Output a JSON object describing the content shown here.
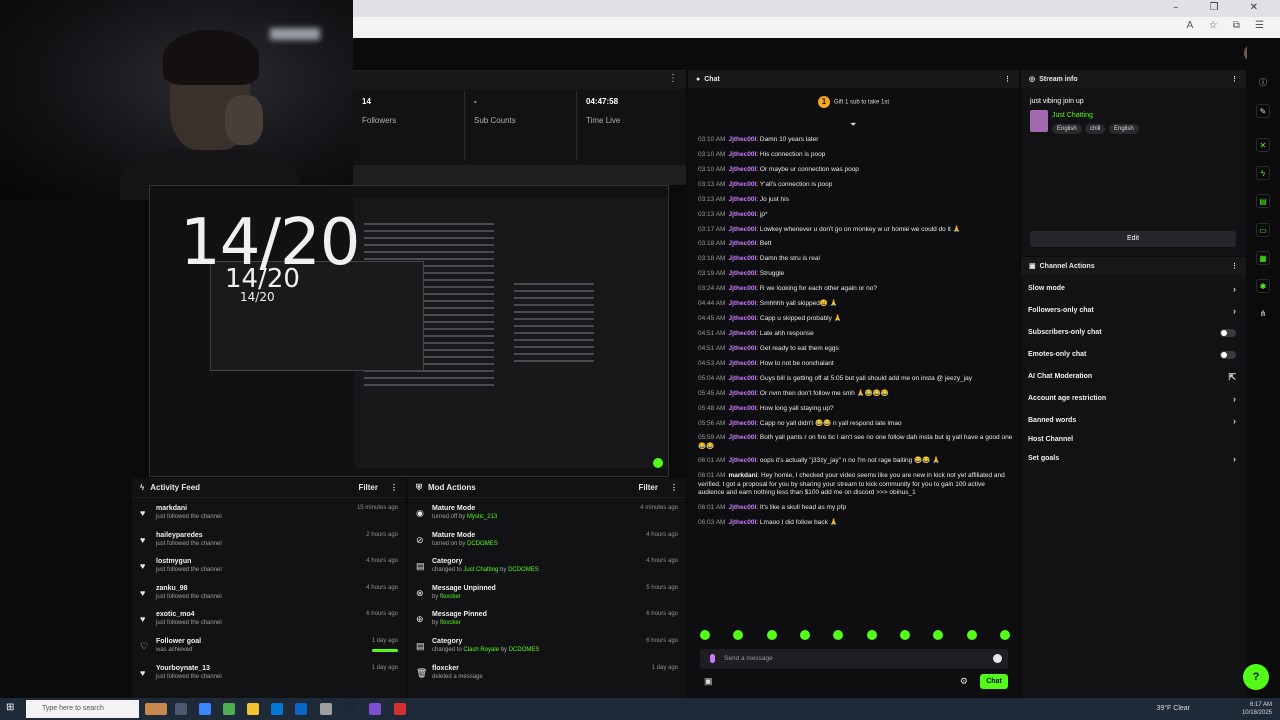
{
  "stats": [
    {
      "value": "14",
      "label": "Followers"
    },
    {
      "value": "-",
      "label": "Sub Counts"
    },
    {
      "value": "04:47:58",
      "label": "Time Live"
    }
  ],
  "preview": {
    "big": "14/20",
    "mid": "14/20",
    "small": "14/20"
  },
  "activity_feed": {
    "title": "Activity Feed",
    "filter": "Filter",
    "items": [
      {
        "name": "markdani",
        "sub": "just followed the channel",
        "time": "15 minutes ago"
      },
      {
        "name": "haileyparedes",
        "sub": "just followed the channel",
        "time": "2 hours ago"
      },
      {
        "name": "lostmygun",
        "sub": "just followed the channel",
        "time": "4 hours ago"
      },
      {
        "name": "zanku_98",
        "sub": "just followed the channel",
        "time": "4 hours ago"
      },
      {
        "name": "exotic_mo4",
        "sub": "just followed the channel",
        "time": "6 hours ago"
      },
      {
        "name": "Follower goal",
        "sub": "was achieved",
        "time": "1 day ago"
      },
      {
        "name": "Yourboynate_13",
        "sub": "just followed the channel",
        "time": "1 day ago"
      }
    ]
  },
  "mod_actions": {
    "title": "Mod Actions",
    "filter": "Filter",
    "items": [
      {
        "name": "Mature Mode",
        "pre": "turned off by ",
        "who": "Mystic_213",
        "post": "",
        "time": "4 minutes ago"
      },
      {
        "name": "Mature Mode",
        "pre": "turned on by ",
        "who": "DCDOMES",
        "post": "",
        "time": "4 hours ago"
      },
      {
        "name": "Category",
        "pre": "changed to ",
        "who": "Just Chatting",
        "post": " by ",
        "who2": "DCDOMES",
        "time": "4 hours ago"
      },
      {
        "name": "Message Unpinned",
        "pre": "by ",
        "who": "floxcker",
        "post": "",
        "time": "5 hours ago"
      },
      {
        "name": "Message Pinned",
        "pre": "by ",
        "who": "floxcker",
        "post": "",
        "time": "6 hours ago"
      },
      {
        "name": "Category",
        "pre": "changed to ",
        "who": "Clash Royale",
        "post": " by ",
        "who2": "DCDOMES",
        "time": "6 hours ago"
      },
      {
        "name": "floxcker",
        "pre": "deleted a message",
        "who": "",
        "post": "",
        "time": "1 day ago"
      }
    ]
  },
  "chat": {
    "title": "Chat",
    "gift_text": "Gift 1 sub to take 1st",
    "gift_count": "1",
    "input_placeholder": "Send a message",
    "send_label": "Chat",
    "messages": [
      {
        "time": "03:10 AM",
        "user": "Jjthec00l",
        "text": "Damn 10 years later"
      },
      {
        "time": "03:10 AM",
        "user": "Jjthec00l",
        "text": "His connection is poop"
      },
      {
        "time": "03:10 AM",
        "user": "Jjthec00l",
        "text": "Or maybe ur connection was poop"
      },
      {
        "time": "03:13 AM",
        "user": "Jjthec00l",
        "text": "Y'all's connection is poop"
      },
      {
        "time": "03:13 AM",
        "user": "Jjthec00l",
        "text": "Jo just his"
      },
      {
        "time": "03:13 AM",
        "user": "Jjthec00l",
        "text": "jp*"
      },
      {
        "time": "03:17 AM",
        "user": "Jjthec00l",
        "text": "Lowkey whenever u don't go on monkey w ur homie we could do it 🙏"
      },
      {
        "time": "03:18 AM",
        "user": "Jjthec00l",
        "text": "Bett"
      },
      {
        "time": "03:18 AM",
        "user": "Jjthec00l",
        "text": "Damn the stru is real"
      },
      {
        "time": "03:19 AM",
        "user": "Jjthec00l",
        "text": "Struggle"
      },
      {
        "time": "03:24 AM",
        "user": "Jjthec00l",
        "text": "R we looking for each other again or no?"
      },
      {
        "time": "04:44 AM",
        "user": "Jjthec00l",
        "text": "Smhhhh yall skipped😩 🙏"
      },
      {
        "time": "04:45 AM",
        "user": "Jjthec00l",
        "text": "Capp u skipped probably 🙏"
      },
      {
        "time": "04:51 AM",
        "user": "Jjthec00l",
        "text": "Late ahh response"
      },
      {
        "time": "04:51 AM",
        "user": "Jjthec00l",
        "text": "Get ready to eat them eggs"
      },
      {
        "time": "04:53 AM",
        "user": "Jjthec00l",
        "text": "How to not be nonchalant"
      },
      {
        "time": "05:04 AM",
        "user": "Jjthec00l",
        "text": "Guys bill is getting off at 5:05 but yall should add me on insta @ jeezy_jay"
      },
      {
        "time": "05:45 AM",
        "user": "Jjthec00l",
        "text": "Or nvm then don't follow me smh 🙏😂😂😂"
      },
      {
        "time": "05:48 AM",
        "user": "Jjthec00l",
        "text": "How long yall staying up?"
      },
      {
        "time": "05:56 AM",
        "user": "Jjthec00l",
        "text": "Capp no yall didn't 😂😂 n yall respond late lmao"
      },
      {
        "time": "05:59 AM",
        "user": "Jjthec00l",
        "text": "Both yall pants r on fire bc I ain't see no one follow dah insta but ig yall have a good one 😂😂"
      },
      {
        "time": "06:01 AM",
        "user": "Jjthec00l",
        "text": "oops it's actually \"j33zy_jay\" n no I'm not rage baiting 😂😂 🙏"
      },
      {
        "time": "06:01 AM",
        "user": "markdani",
        "text": "Hey homie, I checked your video seems like you are new in kick not yet affiliated and verified. I got a proposal for you by sharing your stream to kick community for you to gain 100 active audience and earn nothing less than $100 add me on discord >>> obinus_1"
      },
      {
        "time": "06:01 AM",
        "user": "Jjthec00l",
        "text": "It's like a skull head as my pfp"
      },
      {
        "time": "06:03 AM",
        "user": "Jjthec00l",
        "text": "Lmaoo I did follow back 🙏"
      }
    ]
  },
  "stream_info": {
    "title": "Stream info",
    "stream_title": "just vibing join up",
    "category": "Just Chatting",
    "tags": [
      "English",
      "chill",
      "English"
    ],
    "edit_label": "Edit"
  },
  "channel_actions": {
    "title": "Channel Actions",
    "items": [
      {
        "label": "Slow mode",
        "control": "chevron"
      },
      {
        "label": "Followers-only chat",
        "control": "chevron"
      },
      {
        "label": "Subscribers-only chat",
        "control": "toggle"
      },
      {
        "label": "Emotes-only chat",
        "control": "toggle"
      },
      {
        "label": "AI Chat Moderation",
        "control": "external"
      },
      {
        "label": "Account age restriction",
        "control": "chevron"
      },
      {
        "label": "Banned words",
        "control": "chevron"
      },
      {
        "label": "Host Channel",
        "control": "none"
      },
      {
        "label": "Set goals",
        "control": "chevron"
      }
    ]
  },
  "taskbar": {
    "search_placeholder": "Type here to search",
    "weather": "39°F  Clear",
    "time": "6:17 AM",
    "date": "10/18/2025"
  },
  "colors": {
    "accent": "#53fc18",
    "username": "#c77dff",
    "bg": "#0e0e10"
  }
}
